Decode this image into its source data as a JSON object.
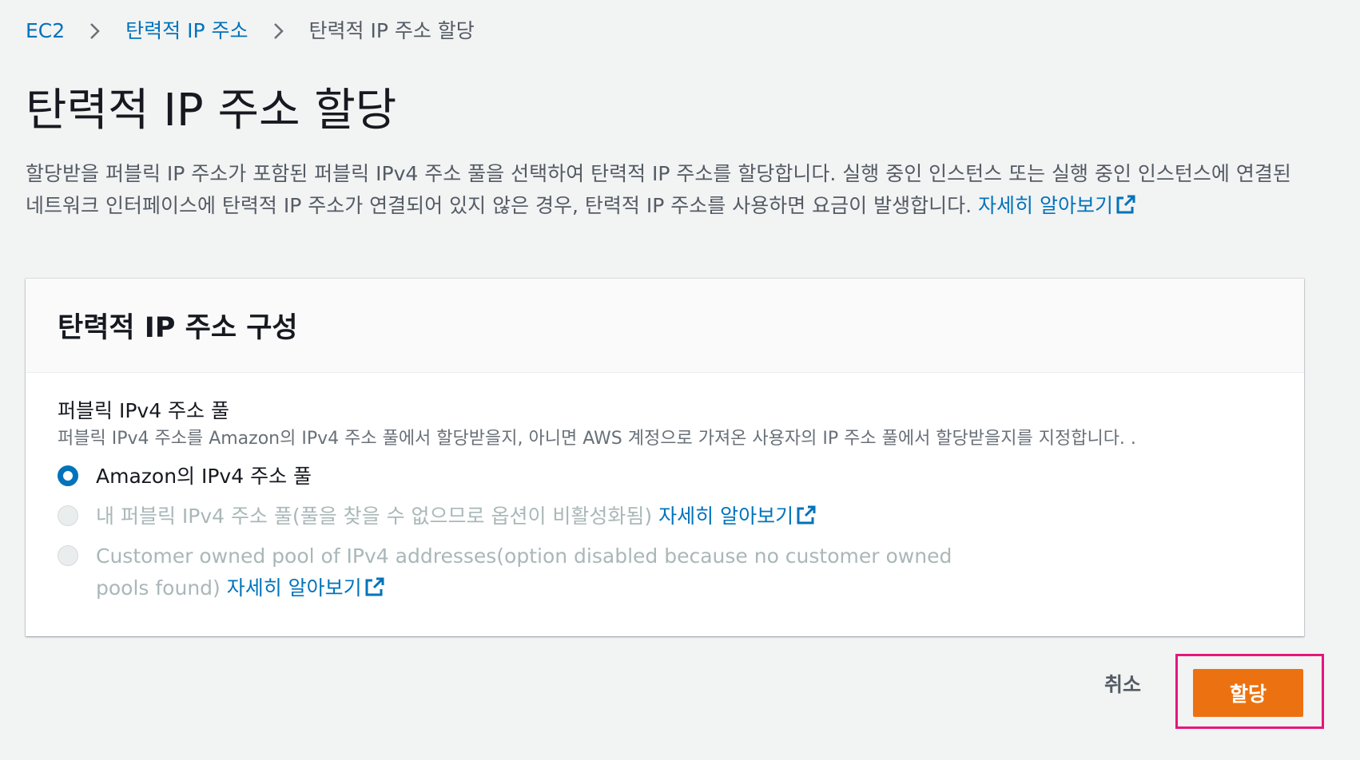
{
  "breadcrumb": {
    "items": [
      {
        "label": "EC2"
      },
      {
        "label": "탄력적 IP 주소"
      },
      {
        "label": "탄력적 IP 주소 할당"
      }
    ]
  },
  "page": {
    "title": "탄력적 IP 주소 할당",
    "description": "할당받을 퍼블릭 IP 주소가 포함된 퍼블릭 IPv4 주소 풀을 선택하여 탄력적 IP 주소를 할당합니다. 실행 중인 인스턴스 또는 실행 중인 인스턴스에 연결된 네트워크 인터페이스에 탄력적 IP 주소가 연결되어 있지 않은 경우, 탄력적 IP 주소를 사용하면 요금이 발생합니다. ",
    "learn_more": "자세히 알아보기"
  },
  "card": {
    "title": "탄력적 IP 주소 구성",
    "field_label": "퍼블릭 IPv4 주소 풀",
    "field_description": "퍼블릭 IPv4 주소를 Amazon의 IPv4 주소 풀에서 할당받을지, 아니면 AWS 계정으로 가져온 사용자의 IP 주소 풀에서 할당받을지를 지정합니다. .",
    "options": [
      {
        "label": "Amazon의 IPv4 주소 풀",
        "selected": true,
        "disabled": false
      },
      {
        "label": "내 퍼블릭 IPv4 주소 풀(풀을 찾을 수 없으므로 옵션이 비활성화됨) ",
        "link": "자세히 알아보기",
        "selected": false,
        "disabled": true
      },
      {
        "label": "Customer owned pool of IPv4 addresses(option disabled because no customer owned pools found) ",
        "link": "자세히 알아보기",
        "selected": false,
        "disabled": true
      }
    ]
  },
  "actions": {
    "cancel_label": "취소",
    "allocate_label": "할당"
  },
  "colors": {
    "link": "#0073bb",
    "primary_button": "#ec7211",
    "highlight": "#e7157b",
    "background": "#f2f3f3"
  }
}
